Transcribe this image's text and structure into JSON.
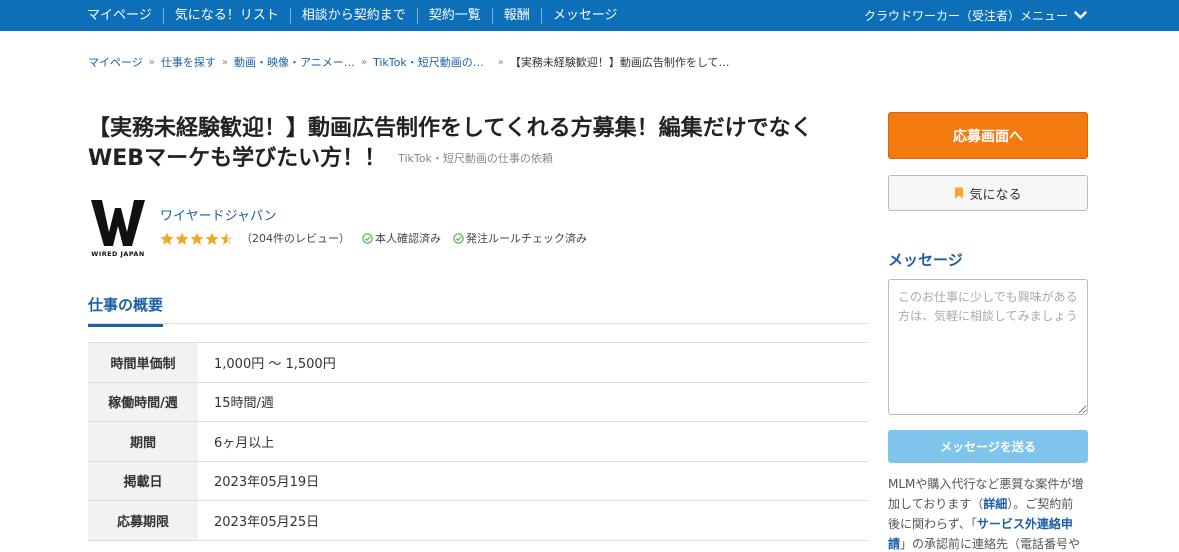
{
  "nav": {
    "items": [
      "マイページ",
      "気になる！リスト",
      "相談から契約まで",
      "契約一覧",
      "報酬",
      "メッセージ"
    ],
    "menu_label": "クラウドワーカー（受注者）メニュー"
  },
  "breadcrumb": {
    "items": [
      "マイページ",
      "仕事を探す",
      "動画・映像・アニメー…",
      "TikTok・短尺動画の…"
    ],
    "current": "【実務未経験歓迎！】動画広告制作をして…"
  },
  "job": {
    "title": "【実務未経験歓迎！】動画広告制作をしてくれる方募集！編集だけでなくWEBマーケも学びたい方！！",
    "category": "TikTok・短尺動画の仕事の依頼"
  },
  "client": {
    "logo_text": "WIRED JAPAN",
    "name": "ワイヤードジャパン",
    "rating": 4.5,
    "reviews": "（204件のレビュー）",
    "identity_verified": "本人確認済み",
    "rule_checked": "発注ルールチェック済み"
  },
  "overview": {
    "tab_label": "仕事の概要",
    "rows": [
      {
        "label": "時間単価制",
        "value": "1,000円 〜 1,500円"
      },
      {
        "label": "稼働時間/週",
        "value": "15時間/週"
      },
      {
        "label": "期間",
        "value": "6ヶ月以上"
      },
      {
        "label": "掲載日",
        "value": "2023年05月19日"
      },
      {
        "label": "応募期限",
        "value": "2023年05月25日"
      }
    ]
  },
  "sidebar": {
    "apply_label": "応募画面へ",
    "favorite_label": "気になる",
    "message_heading": "メッセージ",
    "message_placeholder": "このお仕事に少しでも興味がある方は、気軽に相談してみましょう",
    "send_label": "メッセージを送る",
    "notice": {
      "part1": "MLMや購入代行など悪質な案件が増加しております（",
      "link1": "詳細",
      "part2": "）。ご契約前後に関わらず、「",
      "link2": "サービス外連絡申請",
      "part3": "」の承認前に連絡先（電話番号や"
    }
  },
  "colors": {
    "nav_bg": "#0c6fb8",
    "link": "#1a5fa8",
    "apply": "#f27a0f",
    "send": "#7fc4ea",
    "star": "#f5a623",
    "check": "#5cb85c"
  }
}
